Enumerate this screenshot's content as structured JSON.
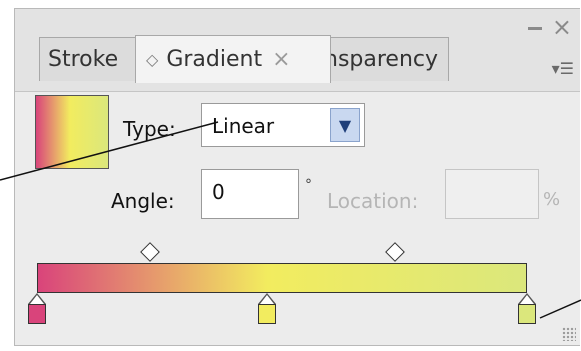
{
  "tabs": [
    {
      "label": "Stroke"
    },
    {
      "label": "Gradient"
    },
    {
      "label": "nsparency"
    }
  ],
  "icons": {
    "tab_diamond": "◇",
    "tab_close": "×",
    "window_close": "×",
    "panel_menu": "▾☰",
    "dropdown": "▼",
    "degree": "°"
  },
  "form": {
    "type_label": "Type:",
    "type_value": "Linear",
    "angle_label": "Angle:",
    "angle_value": "0",
    "location_label": "Location:",
    "location_value": "",
    "percent": "%"
  },
  "gradient": {
    "colors": [
      "#e0437b",
      "#f0ee5e",
      "#dde57a"
    ],
    "stops": [
      {
        "color": "#d9447b",
        "position": 0
      },
      {
        "color": "#f2ec5f",
        "position": 0.47
      },
      {
        "color": "#dbe77c",
        "position": 1
      }
    ],
    "midpoints": [
      0.23,
      0.73
    ]
  }
}
